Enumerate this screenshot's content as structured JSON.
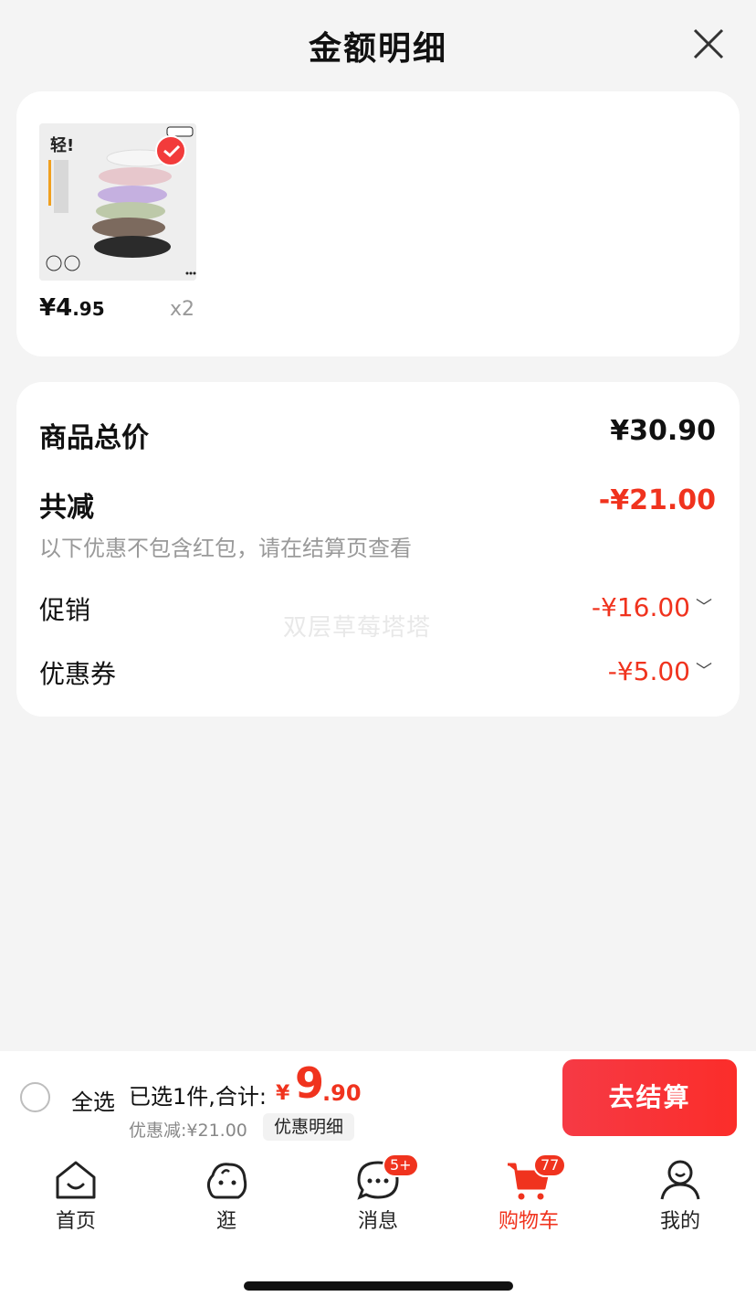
{
  "sheet": {
    "title": "金额明细",
    "close_icon": "close-icon"
  },
  "product": {
    "image_text": "轻!",
    "price_int": "¥4",
    "price_dec": ".95",
    "quantity": "x2",
    "checked": true
  },
  "breakdown": {
    "total_label": "商品总价",
    "total_value": "¥30.90",
    "reduce_label": "共减",
    "reduce_value": "-¥21.00",
    "reduce_note": "以下优惠不包含红包，请在结算页查看",
    "promo_label": "促销",
    "promo_value": "-¥16.00",
    "coupon_label": "优惠券",
    "coupon_value": "-¥5.00"
  },
  "watermark": "双层草莓塔塔",
  "bottom_bar": {
    "select_all": "全选",
    "selected_text": "已选1件,合计:",
    "total_symbol": "¥",
    "total_int": "9",
    "total_dec": ".90",
    "discount_text": "优惠减:¥21.00",
    "detail_chip": "优惠明细",
    "checkout": "去结算"
  },
  "tabs": [
    {
      "label": "首页",
      "icon": "home-icon"
    },
    {
      "label": "逛",
      "icon": "browse-icon"
    },
    {
      "label": "消息",
      "icon": "message-icon",
      "badge": "5+"
    },
    {
      "label": "购物车",
      "icon": "cart-icon",
      "badge": "77",
      "active": true
    },
    {
      "label": "我的",
      "icon": "profile-icon"
    }
  ],
  "colors": {
    "accent": "#f0331e",
    "checkout": "#f63a45"
  }
}
